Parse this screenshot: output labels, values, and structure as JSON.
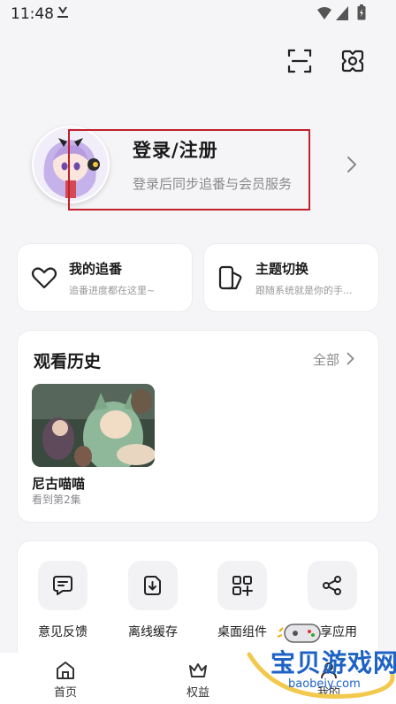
{
  "status_bar": {
    "time": "11:48"
  },
  "profile": {
    "title": "登录/注册",
    "subtitle": "登录后同步追番与会员服务"
  },
  "quick_cards": [
    {
      "title": "我的追番",
      "subtitle": "追番进度都在这里~",
      "icon": "heart-icon"
    },
    {
      "title": "主题切换",
      "subtitle": "跟随系统就是你的手...",
      "icon": "theme-icon"
    }
  ],
  "history": {
    "title": "观看历史",
    "all_label": "全部",
    "items": [
      {
        "title": "尼古喵喵",
        "progress": "看到第2集"
      }
    ]
  },
  "tools": [
    {
      "label": "意见反馈",
      "icon": "feedback-icon"
    },
    {
      "label": "离线缓存",
      "icon": "download-icon"
    },
    {
      "label": "桌面组件",
      "icon": "widget-icon"
    },
    {
      "label": "分享应用",
      "icon": "share-icon"
    }
  ],
  "tabbar": [
    {
      "label": "首页",
      "icon": "home-icon"
    },
    {
      "label": "权益",
      "icon": "crown-icon"
    },
    {
      "label": "我的",
      "icon": "profile-icon"
    }
  ],
  "watermark": {
    "name": "宝贝游戏网",
    "url": "baobeiy.com"
  },
  "colors": {
    "highlight_border": "#c0212b",
    "watermark": "#1e63c4"
  }
}
